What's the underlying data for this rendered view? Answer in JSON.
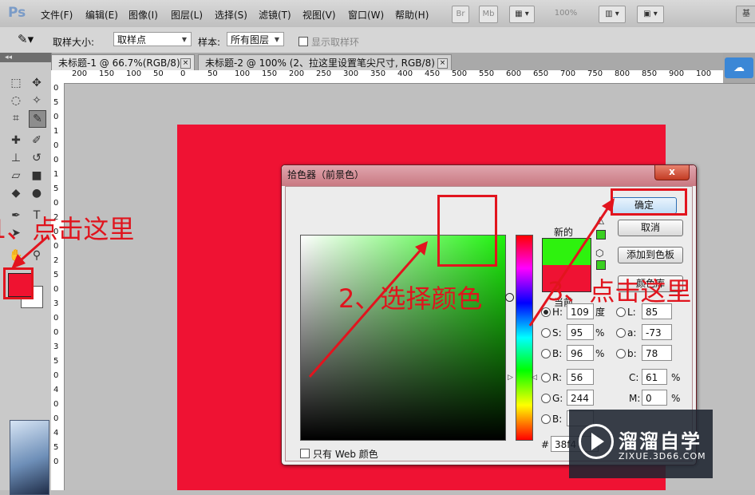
{
  "menubar": {
    "logo": "Ps",
    "items": [
      "文件(F)",
      "编辑(E)",
      "图像(I)",
      "图层(L)",
      "选择(S)",
      "滤镜(T)",
      "视图(V)",
      "窗口(W)",
      "帮助(H)"
    ],
    "bridge": "Br",
    "minibridge": "Mb",
    "zoom": "100%",
    "right_label": "基"
  },
  "options": {
    "sample_size_label": "取样大小:",
    "sample_size_value": "取样点",
    "sample_label": "样本:",
    "sample_value": "所有图层",
    "show_ring_label": "显示取样环"
  },
  "tabs": [
    {
      "title": "未标题-1 @ 66.7%(RGB/8) *",
      "close": "×"
    },
    {
      "title": "未标题-2 @ 100% (2、拉这里设置笔尖尺寸, RGB/8) *",
      "close": "×"
    }
  ],
  "toolbox": {
    "collapse": "◂◂"
  },
  "ruler_top": [
    "200",
    "150",
    "100",
    "50",
    "0",
    "50",
    "100",
    "150",
    "200",
    "250",
    "300",
    "350",
    "400",
    "450",
    "500",
    "550",
    "600",
    "650",
    "700",
    "750",
    "800",
    "850",
    "900",
    "100"
  ],
  "ruler_left": [
    "0",
    "5",
    "0",
    "1",
    "0",
    "0",
    "1",
    "5",
    "0",
    "2",
    "0",
    "0",
    "2",
    "5",
    "0",
    "3",
    "0",
    "0",
    "3",
    "5",
    "0",
    "4",
    "0",
    "0",
    "4",
    "5",
    "0"
  ],
  "dialog": {
    "title": "拾色器（前景色）",
    "close": "x",
    "new_label": "新的",
    "current_label": "当前",
    "buttons": {
      "ok": "确定",
      "cancel": "取消",
      "add_swatch": "添加到色板",
      "libraries": "颜色库"
    },
    "fields": {
      "H": {
        "label": "H:",
        "value": "109",
        "unit": "度"
      },
      "S": {
        "label": "S:",
        "value": "95",
        "unit": "%"
      },
      "B": {
        "label": "B:",
        "value": "96",
        "unit": "%"
      },
      "R": {
        "label": "R:",
        "value": "56"
      },
      "G": {
        "label": "G:",
        "value": "244"
      },
      "Bl": {
        "label": "B:",
        "value": ""
      },
      "L": {
        "label": "L:",
        "value": "85"
      },
      "a": {
        "label": "a:",
        "value": "-73"
      },
      "b": {
        "label": "b:",
        "value": "78"
      },
      "C": {
        "label": "C:",
        "value": "61",
        "unit": "%"
      },
      "M": {
        "label": "M:",
        "value": "0",
        "unit": "%"
      }
    },
    "hex_label": "#",
    "hex_value": "38f4",
    "web_only": "只有 Web 颜色",
    "new_color": "#2ef20e",
    "current_color": "#ef1233"
  },
  "annotations": {
    "step1": "1、点击这里",
    "step2": "2、选择颜色",
    "step3": "3、点击这里",
    "color": "#e2141e"
  },
  "watermark": {
    "title": "溜溜自学",
    "url": "ZIXUE.3D66.COM"
  },
  "colors": {
    "canvas": "#ef1233",
    "foreground": "#ef1230",
    "accent_blue": "#3b87d6"
  }
}
